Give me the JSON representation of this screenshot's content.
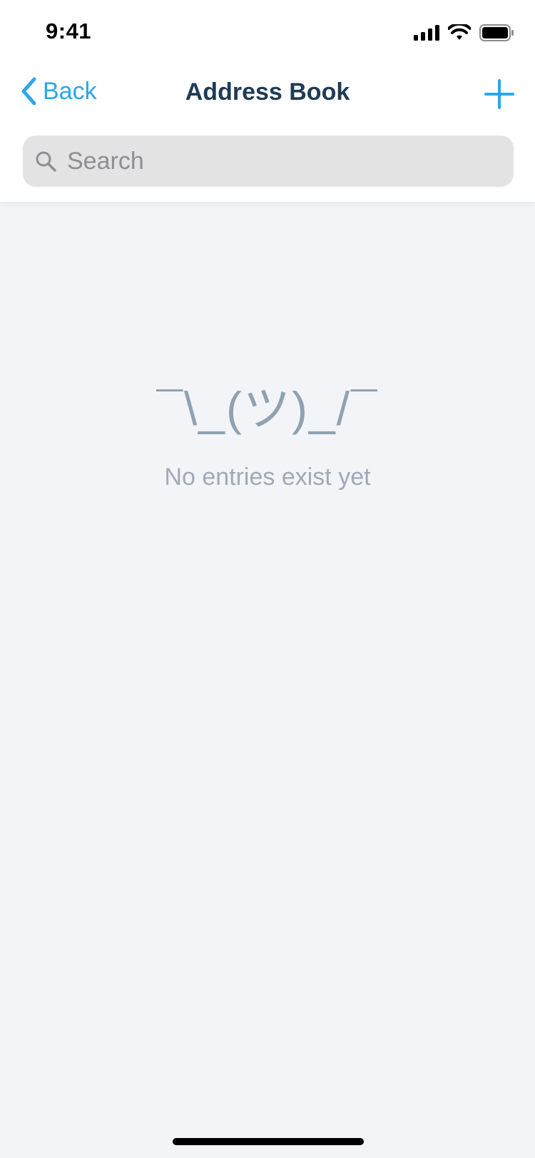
{
  "status_bar": {
    "time": "9:41"
  },
  "nav": {
    "back_label": "Back",
    "title": "Address Book"
  },
  "search": {
    "placeholder": "Search",
    "value": ""
  },
  "empty_state": {
    "emoticon": "¯\\_(ツ)_/¯",
    "message": "No entries exist yet"
  },
  "colors": {
    "accent": "#2ca6e8",
    "title": "#1f3b55",
    "background": "#f2f4f7",
    "muted": "#a1a9b6"
  }
}
